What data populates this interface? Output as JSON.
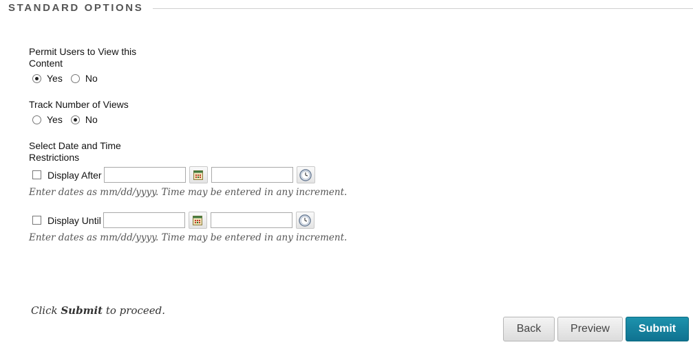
{
  "section": {
    "title": "STANDARD OPTIONS"
  },
  "permit_view": {
    "label": "Permit Users to View this Content",
    "options": [
      {
        "label": "Yes",
        "checked": true
      },
      {
        "label": "No",
        "checked": false
      }
    ]
  },
  "track_views": {
    "label": "Track Number of Views",
    "options": [
      {
        "label": "Yes",
        "checked": false
      },
      {
        "label": "No",
        "checked": true
      }
    ]
  },
  "date_restrictions": {
    "label": "Select Date and Time Restrictions",
    "display_after": {
      "label": "Display After",
      "checked": false,
      "date_value": "",
      "time_value": ""
    },
    "display_until": {
      "label": "Display Until",
      "checked": false,
      "date_value": "",
      "time_value": ""
    },
    "hint": "Enter dates as mm/dd/yyyy. Time may be entered in any increment."
  },
  "footer": {
    "note_prefix": "Click ",
    "note_bold": "Submit",
    "note_suffix": " to proceed.",
    "back_label": "Back",
    "preview_label": "Preview",
    "submit_label": "Submit"
  },
  "colors": {
    "primary": "#127c98",
    "section_title": "#555555",
    "hint_text": "#555555"
  },
  "icons": {
    "calendar": "calendar-icon",
    "clock": "clock-icon"
  }
}
